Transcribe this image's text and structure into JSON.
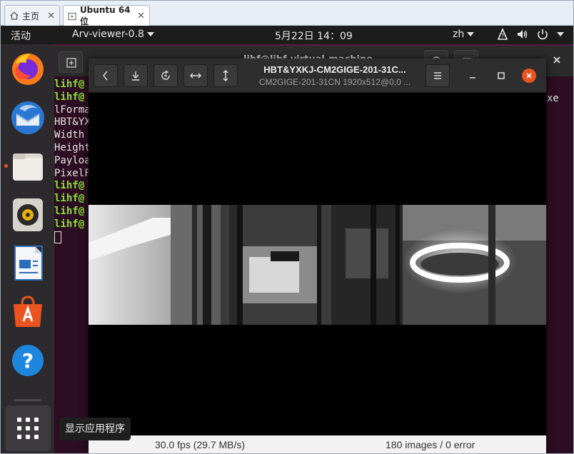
{
  "host_tabs": [
    {
      "label": "主页"
    },
    {
      "label": "Ubuntu 64 位"
    }
  ],
  "topbar": {
    "activities": "活动",
    "app_menu": "Arv-viewer-0.8",
    "clock": "5月22日  14：09",
    "input_method": "zh"
  },
  "terminal": {
    "title_partial": "lihf@lihf-virtual-machine",
    "lines": [
      {
        "text": "lihf@",
        "prompt": true
      },
      {
        "text": "lihf@",
        "prompt": true
      },
      {
        "text": "lForma",
        "prompt": false
      },
      {
        "text": "HBT&YX",
        "prompt": false
      },
      {
        "text": "Width ",
        "prompt": false
      },
      {
        "text": "Height",
        "prompt": false
      },
      {
        "text": "Payloa",
        "prompt": false
      },
      {
        "text": "PixelF",
        "prompt": false
      },
      {
        "text": "lihf@",
        "prompt": true
      },
      {
        "text": "lihf@",
        "prompt": true
      },
      {
        "text": "lihf@",
        "prompt": true
      },
      {
        "text": "lihf@",
        "prompt": true
      }
    ],
    "right_fragment": "xe"
  },
  "viewer": {
    "title": "HBT&YXKJ-CM2GIGE-201-31C...",
    "subtitle": "CM2GIGE-201-31CN 1920x512@0,0 ...",
    "fps": "30.0 fps (29.7 MB/s)",
    "images": "180 images / 0 error"
  },
  "tooltip": "显示应用程序",
  "colors": {
    "ubuntu_orange": "#e95420",
    "terminal_bg": "#2c0d22",
    "prompt_green": "#8ae234",
    "dock_bg": "#2d2a2e"
  },
  "icons": [
    "home-icon",
    "vm-icon",
    "firefox-icon",
    "thunderbird-icon",
    "files-icon",
    "rhythmbox-icon",
    "writer-icon",
    "software-icon",
    "help-icon",
    "apps-grid-icon"
  ]
}
